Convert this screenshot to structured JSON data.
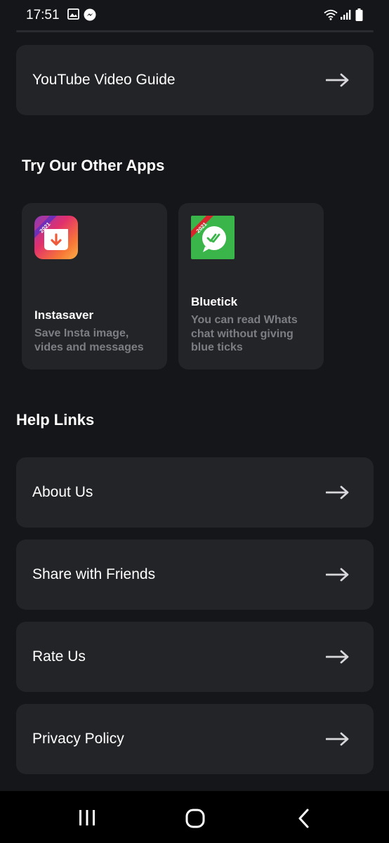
{
  "status_bar": {
    "time": "17:51",
    "left_icons": [
      "image-icon",
      "messenger-icon"
    ],
    "right_icons": [
      "wifi-icon",
      "signal-icon",
      "battery-icon"
    ]
  },
  "list_top": {
    "label": "YouTube Video Guide",
    "icon": "arrow-right-icon"
  },
  "other_apps": {
    "heading": "Try Our Other Apps",
    "apps": [
      {
        "name": "Instasaver",
        "description": "Save Insta image, vides and messages",
        "badge": "2021",
        "icon": "instasaver-logo-icon"
      },
      {
        "name": "Bluetick",
        "description": "You can read Whats chat without giving blue ticks",
        "badge": "2021",
        "icon": "bluetick-logo-icon"
      }
    ]
  },
  "help_links": {
    "heading": "Help Links",
    "items": [
      {
        "label": "About Us",
        "icon": "arrow-right-icon"
      },
      {
        "label": "Share with Friends",
        "icon": "arrow-right-icon"
      },
      {
        "label": "Rate Us",
        "icon": "arrow-right-icon"
      },
      {
        "label": "Privacy Policy",
        "icon": "arrow-right-icon"
      }
    ]
  },
  "nav_bar": {
    "buttons": [
      "recent-apps-icon",
      "home-icon",
      "back-icon"
    ]
  },
  "colors": {
    "background": "#151619",
    "card": "#232428",
    "text": "#ffffff",
    "muted_text": "#7d7e83",
    "nav_background": "#000000"
  }
}
